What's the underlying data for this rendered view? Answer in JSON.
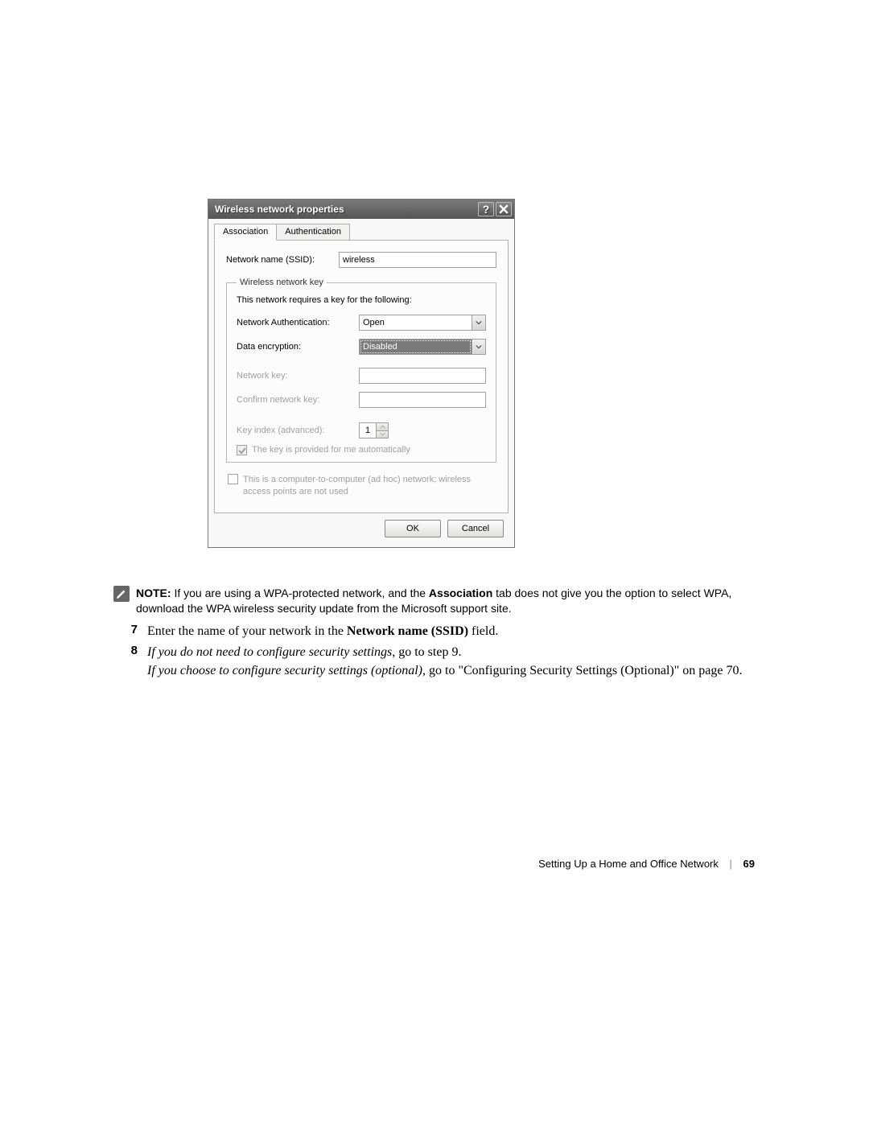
{
  "dialog": {
    "title": "Wireless network properties",
    "help_btn": "?",
    "tabs": {
      "association": "Association",
      "authentication": "Authentication"
    },
    "ssid": {
      "label": "Network name (SSID):",
      "value": "wireless"
    },
    "group_legend": "Wireless network key",
    "group_info": "This network requires a key for the following:",
    "auth": {
      "label": "Network Authentication:",
      "value": "Open"
    },
    "enc": {
      "label": "Data encryption:",
      "value": "Disabled"
    },
    "netkey": {
      "label": "Network key:"
    },
    "confirm": {
      "label": "Confirm network key:"
    },
    "keyidx": {
      "label": "Key index (advanced):",
      "value": "1"
    },
    "auto_chk": "The key is provided for me automatically",
    "adhoc_chk": "This is a computer-to-computer (ad hoc) network; wireless access points are not used",
    "ok": "OK",
    "cancel": "Cancel"
  },
  "note": {
    "label": "NOTE:",
    "text_a": " If you are using a WPA-protected network, and the ",
    "assoc_bold": "Association",
    "text_b": " tab does not give you the option to select WPA, download the WPA wireless security update from the Microsoft support site."
  },
  "steps": {
    "s7": {
      "num": "7",
      "a": "Enter the name of your network in the ",
      "bold": "Network name (SSID)",
      "b": " field."
    },
    "s8": {
      "num": "8",
      "ital_a": "If you do not need to configure security settings",
      "a": ", go to step 9.",
      "ital_b": "If you choose to configure security settings (optional)",
      "b": ", go to \"Configuring Security Settings (Optional)\" on page 70."
    }
  },
  "footer": {
    "section": "Setting Up a Home and Office Network",
    "page": "69"
  }
}
